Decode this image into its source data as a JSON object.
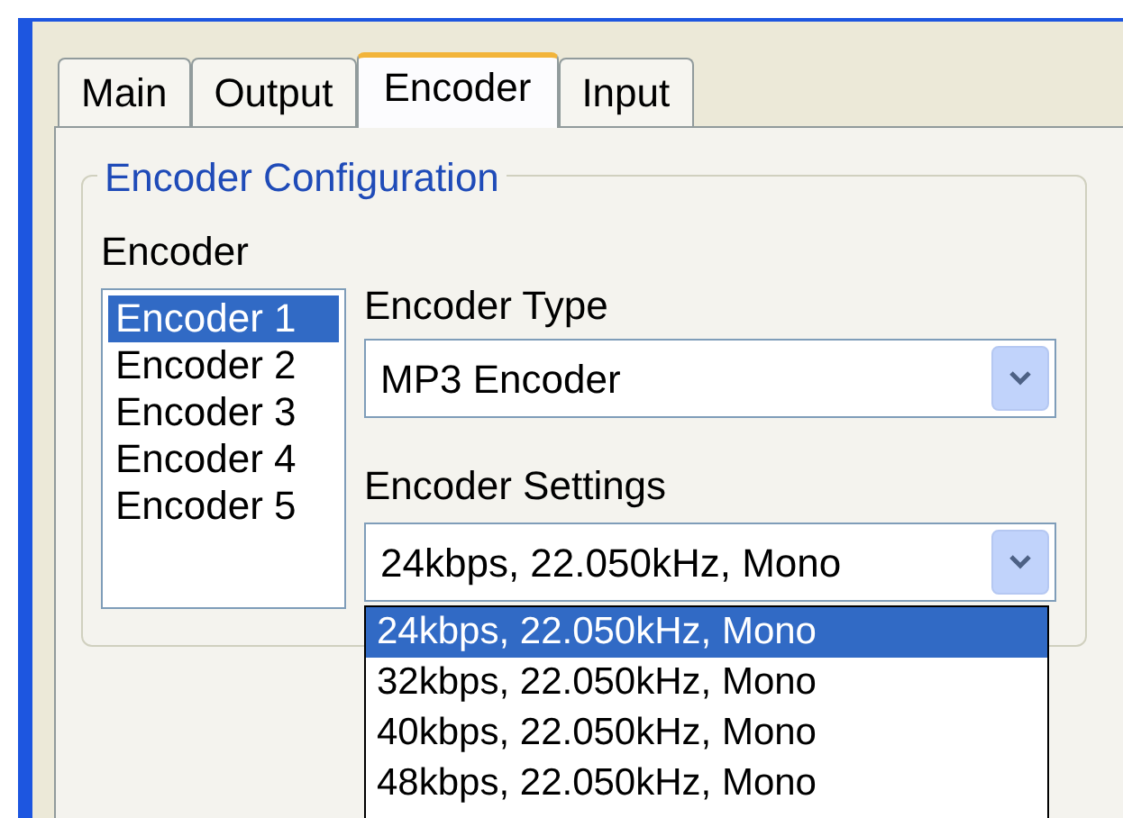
{
  "tabs": [
    {
      "label": "Main",
      "selected": false
    },
    {
      "label": "Output",
      "selected": false
    },
    {
      "label": "Encoder",
      "selected": true
    },
    {
      "label": "Input",
      "selected": false
    }
  ],
  "group": {
    "title": "Encoder Configuration",
    "encoder_label": "Encoder",
    "encoders": [
      {
        "label": "Encoder 1",
        "selected": true
      },
      {
        "label": "Encoder 2",
        "selected": false
      },
      {
        "label": "Encoder 3",
        "selected": false
      },
      {
        "label": "Encoder 4",
        "selected": false
      },
      {
        "label": "Encoder 5",
        "selected": false
      }
    ],
    "type_label": "Encoder Type",
    "type_value": "MP3 Encoder",
    "settings_label": "Encoder Settings",
    "settings_value": "24kbps, 22.050kHz, Mono",
    "settings_options": [
      {
        "label": "24kbps, 22.050kHz, Mono",
        "selected": true
      },
      {
        "label": "32kbps, 22.050kHz, Mono",
        "selected": false
      },
      {
        "label": "40kbps, 22.050kHz, Mono",
        "selected": false
      },
      {
        "label": "48kbps, 22.050kHz, Mono",
        "selected": false
      }
    ]
  }
}
